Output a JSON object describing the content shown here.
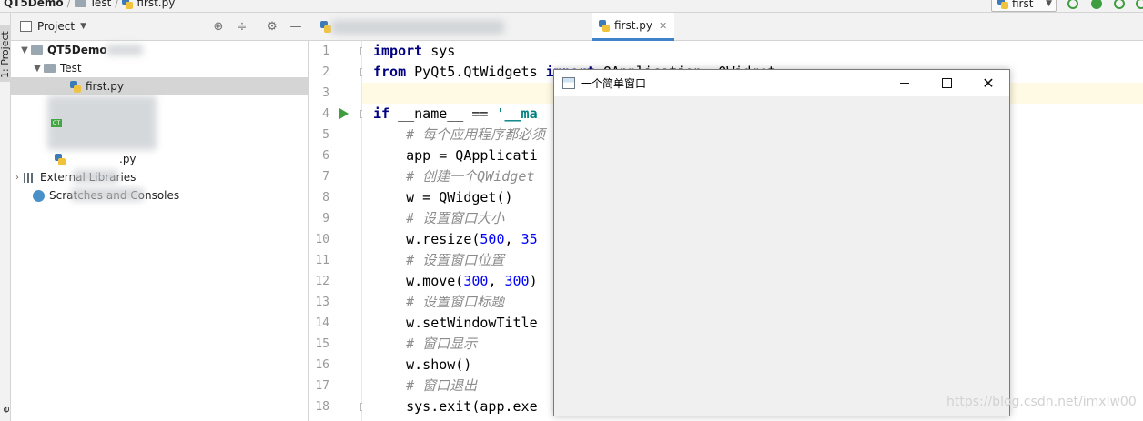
{
  "breadcrumb": {
    "project": "QT5Demo",
    "folder": "Test",
    "file": "first.py"
  },
  "run_config": {
    "name": "first"
  },
  "tool_window": {
    "tab_label": "1: Project",
    "second_tab_label": "e"
  },
  "project_panel": {
    "title": "Project",
    "tree": {
      "root": "QT5Demo",
      "folder": "Test",
      "file": "first.py",
      "qt_badge": "QT",
      "partial_file": ".py",
      "external_libraries": "External Libraries",
      "scratches": "Scratches and Consoles"
    }
  },
  "editor": {
    "active_tab": "first.py",
    "line_numbers": [
      "1",
      "2",
      "3",
      "4",
      "5",
      "6",
      "7",
      "8",
      "9",
      "10",
      "11",
      "12",
      "13",
      "14",
      "15",
      "16",
      "17",
      "18"
    ],
    "lines": [
      "import sys",
      "from PyQt5.QtWidgets import QApplication, QWidget",
      "",
      "if __name__ == '__ma",
      "    # 每个应用程序都必须",
      "    app = QApplicati",
      "    # 创建一个QWidget",
      "    w = QWidget()",
      "    # 设置窗口大小",
      "    w.resize(500, 35",
      "    # 设置窗口位置",
      "    w.move(300, 300)",
      "    # 设置窗口标题",
      "    w.setWindowTitle",
      "    # 窗口显示",
      "    w.show()",
      "    # 窗口退出",
      "    sys.exit(app.exe"
    ]
  },
  "qt_window": {
    "title": "一个简单窗口"
  },
  "watermark": "https://blog.csdn.net/imxlw00"
}
